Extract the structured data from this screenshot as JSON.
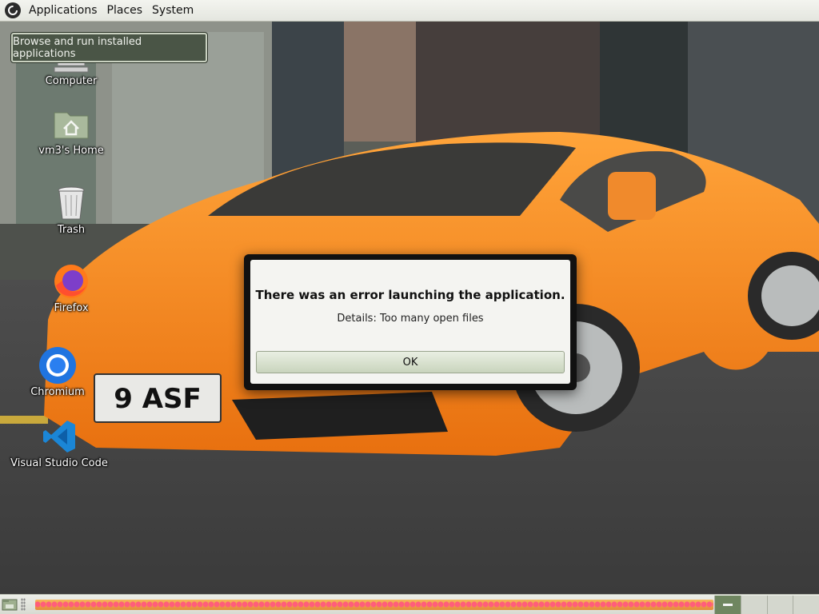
{
  "top_panel": {
    "menus": [
      "Applications",
      "Places",
      "System"
    ]
  },
  "tooltip": {
    "text": "Browse and run installed applications"
  },
  "desktop_icons": [
    {
      "label": "Computer",
      "icon": "computer-icon"
    },
    {
      "label": "vm3's Home",
      "icon": "home-folder-icon"
    },
    {
      "label": "Trash",
      "icon": "trash-icon"
    },
    {
      "label": "Firefox",
      "icon": "firefox-icon"
    },
    {
      "label": "Chromium",
      "icon": "chromium-icon"
    },
    {
      "label": "Visual Studio Code",
      "icon": "vscode-icon"
    }
  ],
  "dialog": {
    "title": "There was an error launching the application.",
    "details": "Details: Too many open files",
    "ok_label": "OK"
  },
  "wallpaper": {
    "plate_text": "9 ASF"
  },
  "bottom_panel": {
    "show_desktop_icon": "show-desktop-icon",
    "workspace_count": 4,
    "active_workspace": 1
  },
  "colors": {
    "car_orange": "#f5871f",
    "panel_green": "#6f8660",
    "tooltip_bg": "#4a5546"
  }
}
